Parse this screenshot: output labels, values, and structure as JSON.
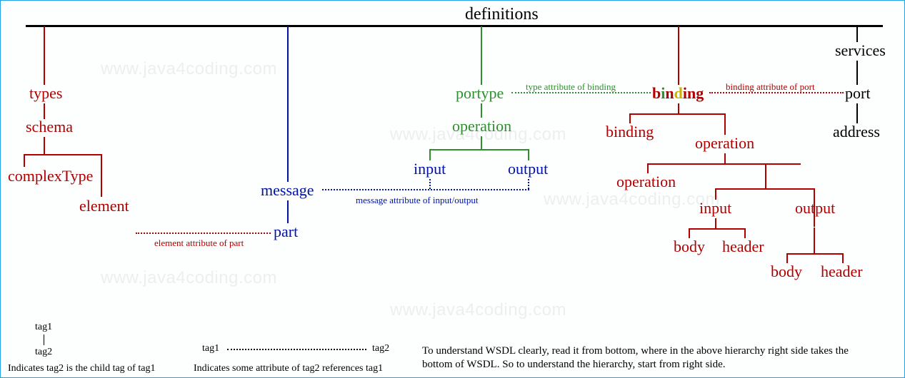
{
  "title": "definitions",
  "watermark": "www.java4coding.com",
  "nodes": {
    "types": "types",
    "schema": "schema",
    "complexType": "complexType",
    "element": "element",
    "message": "message",
    "part": "part",
    "portype": "portype",
    "operation_g": "operation",
    "input_g": "input",
    "output_g": "output",
    "binding_text": "binding",
    "binding_child": "binding",
    "operation_r1": "operation",
    "operation_r2": "operation",
    "input_r": "input",
    "output_r": "output",
    "body_r1": "body",
    "header_r1": "header",
    "body_r2": "body",
    "header_r2": "header",
    "services": "services",
    "port": "port",
    "address": "address"
  },
  "attrs": {
    "element_attr": "element attribute of part",
    "message_attr": "message attribute of input/output",
    "type_attr": "type attribute of binding",
    "binding_attr": "binding attribute of port"
  },
  "legend": {
    "tag1": "tag1",
    "tag2": "tag2",
    "child_note": "Indicates tag2 is the child tag of tag1",
    "ref_note": "Indicates some attribute of tag2 references tag1",
    "body": "To understand WSDL clearly, read it from bottom, where in the above hierarchy right side takes the bottom of WSDL. So to understand the hierarchy, start from right side."
  }
}
